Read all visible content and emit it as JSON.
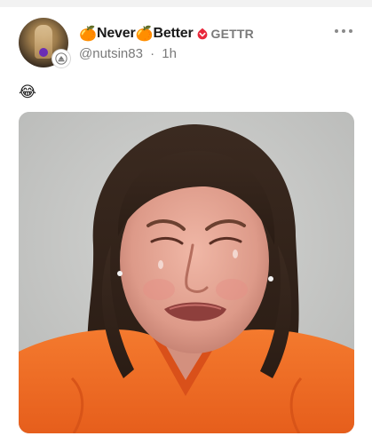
{
  "post": {
    "author": {
      "emoji_prefix": "🍊",
      "name_part1": "Never",
      "emoji_middle": "🍊",
      "name_part2": "Better",
      "platform_label": "GETTR",
      "handle": "@nutsin83",
      "separator": "·",
      "time": "1h"
    },
    "text": "😂",
    "media": {
      "kind": "photo",
      "icon": "mugshot-photo"
    }
  },
  "colors": {
    "gettr_red": "#e8283b",
    "muted_text": "#7a7a7a",
    "jumpsuit_orange": "#ee6a24",
    "backdrop_gray": "#c9cac8"
  }
}
